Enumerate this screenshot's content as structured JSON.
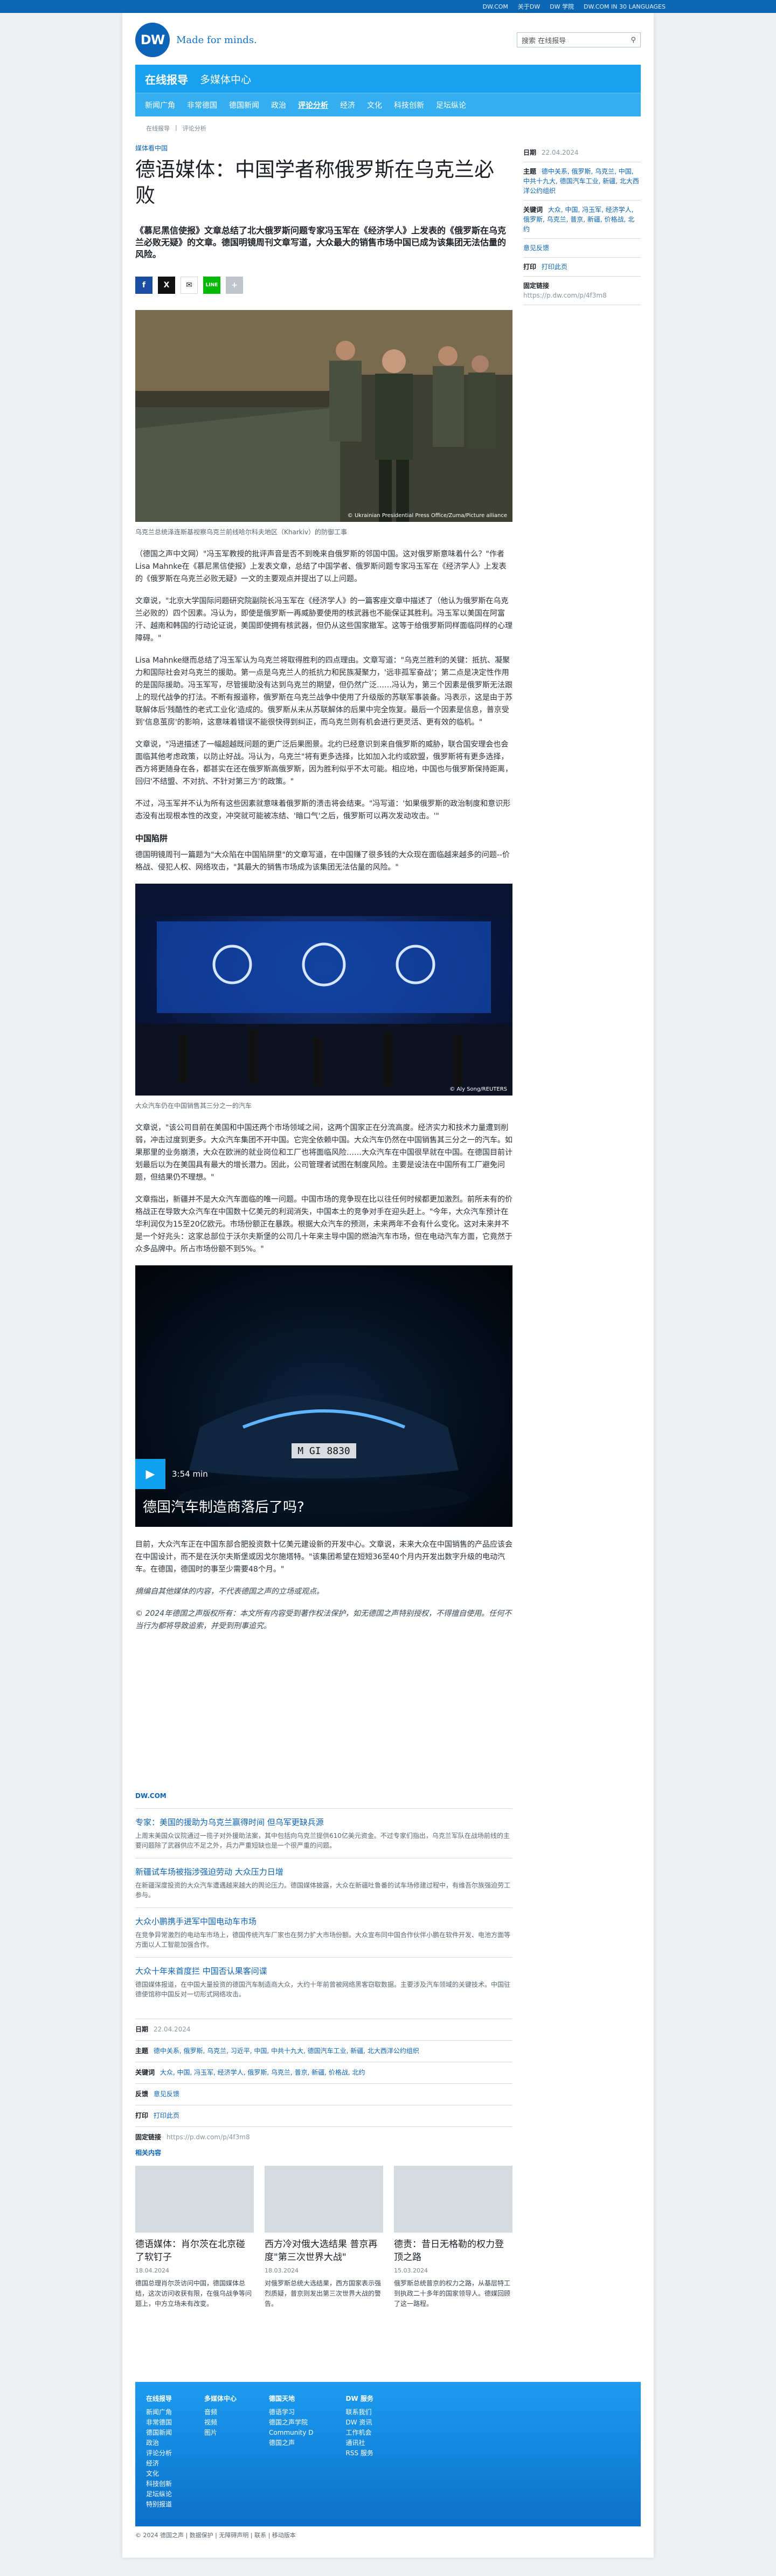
{
  "topbar": {
    "links": [
      "DW.COM",
      "关于DW",
      "DW 学院",
      "DW.COM IN 30 LANGUAGES"
    ]
  },
  "header": {
    "logo": "DW",
    "tagline": "Made for minds.",
    "search_placeholder": "搜索 在线报导"
  },
  "nav": {
    "title": "在线报导",
    "subtitle": "多媒体中心",
    "items": [
      "新闻广角",
      "非常德国",
      "德国新闻",
      "政治",
      "评论分析",
      "经济",
      "文化",
      "科技创新",
      "足坛纵论"
    ]
  },
  "breadcrumb": [
    "在线报导",
    "评论分析"
  ],
  "article": {
    "kicker": "媒体看中国",
    "title": "德语媒体：中国学者称俄罗斯在乌克兰必败",
    "lead": "《慕尼黑信使报》文章总结了北大俄罗斯问题专家冯玉军在《经济学人》上发表的《俄罗斯在乌克兰必败无疑》的文章。德国明镜周刊文章写道，大众最大的销售市场中国已成为该集团无法估量的风险。",
    "share": [
      "f",
      "X",
      "✉",
      "LINE",
      "+"
    ],
    "img1_credit": "© Ukrainian Presidential Press Office/Zuma/Picture alliance",
    "img1_caption": "乌克兰总统泽连斯基视察乌克兰前线哈尔科夫地区（Kharkiv）的防御工事",
    "p1": "（德国之声中文网）\"冯玉军教授的批评声音是否不到晚来自俄罗斯的邻国中国。这对俄罗斯意味着什么？\"作者Lisa Mahnke在《慕尼黑信使报》上发表文章，总结了中国学者、俄罗斯问题专家冯玉军在《经济学人》上发表的《俄罗斯在乌克兰必败无疑》一文的主要观点并提出了以上问题。",
    "p2": "文章说，\"北京大学国际问题研究院副院长冯玉军在《经济学人》的一篇客座文章中描述了（他认为俄罗斯在乌克兰必败的）四个因素。冯认为，即使是俄罗斯一再威胁要使用的核武器也不能保证其胜利。冯玉军以美国在阿富汗、越南和韩国的行动论证说，美国即使拥有核武器，但仍从这些国家撤军。这等于给俄罗斯同样面临同样的心理障碍。\"",
    "p3": "Lisa Mahnke继而总结了冯玉军认为乌克兰将取得胜利的四点理由。文章写道：\"乌克兰胜利的关键：抵抗、凝聚力和国际社会对乌克兰的援助。第一点是乌克兰人的抵抗力和民族凝聚力，'远非孤军奋战'；第二点是决定性作用的是国际援助。冯玉军写，尽管援助没有达到乌克兰的期望，但仍然广泛……冯认为，第三个因素是俄罗斯无法跟上的现代战争的打法。不断有报道称，俄罗斯在乌克兰战争中使用了升级版的苏联军事装备。冯表示，这是由于苏联解体后'残酷性的老式工业化'造成的。俄罗斯从未从苏联解体的后果中完全恢复。最后一个因素是信息，普京受到'信息茧房'的影响，这意味着错误不能很快得到纠正，而乌克兰则有机会进行更灵活、更有效的临机。\"",
    "p4": "文章说，\"冯进描述了一幅超越既问题的更广泛后果图景。北约已经意识到来自俄罗斯的威胁，联合国安理会也会面临其他考虑政策，以防止好战。冯认为，乌克兰\"将有更多选择，比如加入北约或欧盟，俄罗斯将有更多选择，西方将更随身在各，都甚实在还在俄罗斯高俄罗斯，因为胜利似乎不太可能。相应地，中国也与俄罗斯保持距离，回归'不结盟、不对抗、不针对第三方'的政策。\"",
    "p5": "不过，冯玉军并不认为所有这些因素就意味着俄罗斯的溃击将会结束。\"冯写道：'如果俄罗斯的政治制度和意识形态没有出现根本性的改变，冲突就可能被冻结、'暗口气'之后，俄罗斯可以再次发动攻击。'\"",
    "h2": "中国陷阱",
    "p6": "德国明镜周刊一篇题为\"大众陷在中国陷阱里\"的文章写道，在中国赚了很多钱的大众现在面临越来越多的问题--价格战、侵犯人权、网络攻击，\"其最大的销售市场成为该集团无法估量的风险。\"",
    "img2_credit": "© Aly Song/REUTERS",
    "img2_caption": "大众汽车仍在中国销售其三分之一的汽车",
    "p7": "文章说，\"该公司目前在美国和中国还两个市场领域之间，这两个国家正在分流高度。经济实力和技术力量遭到削弱，冲击过度到更多。大众汽车集团不开中国。它完全依赖中国。大众汽车仍然在中国销售其三分之一的汽车。如果那里的业务崩溃，大众在欧洲的就业岗位和工厂也将面临风险……大众汽车在中国很早就在中国。在德国目前计划最后以为在美国具有最大的增长潜力。因此，公司管理者试图在制度风险。主要是设法在中国所有工厂避免问题，但结果仍不理想。\"",
    "p8": "文章指出，新疆并不是大众汽车面临的唯一问题。中国市场的竞争现在比以往任何时候都更加激烈。前所未有的价格战正在导致大众汽车在中国数十亿美元的利润消失，中国本土的竞争对手在迎头赶上。\"今年，大众汽车预计在华利润仅为15至20亿欧元。市场份额正在暴跌。根据大众汽车的预测，未来两年不会有什么变化。这对未来并不是一个好兆头：这家总部位于沃尔夫斯堡的公司几十年来主导中国的燃油汽车市场，但在电动汽车方面，它竟然于众多品牌中。所占市场份额不到5%。\"",
    "video_duration": "3:54 min",
    "video_title": "德国汽车制造商落后了吗?",
    "p9": "目前，大众汽车正在中国东部合肥投资数十亿美元建设新的开发中心。文章说，未来大众在中国销售的产品应该会在中国设计，而不是在沃尔夫斯堡或因戈尔施塔特。\"该集团希望在短短36至40个月内开发出数字升级的电动汽车。在德国，德国时的事至少需要48个月。\"",
    "note": "摘编自其他媒体的内容，不代表德国之声的立场或观点。",
    "copyright": "© 2024年德国之声版权所有：本文所有内容受到著作权法保护，如无德国之声特别授权，不得擅自使用。任何不当行为都将导致追索，并受到刑事追究。"
  },
  "sidebar": {
    "date_label": "日期",
    "date": "22.04.2024",
    "topics_label": "主题",
    "topics": "德中关系, 俄罗斯, 乌克兰, 中国, 中共十九大, 德国汽车工业, 新疆, 北大西洋公约组织",
    "keywords_label": "关键词",
    "keywords": "大众, 中国, 冯玉军, 经济学人, 俄罗斯, 乌克兰, 普京, 新疆, 价格战, 北约",
    "feedback": "意见反馈",
    "print_label": "打印",
    "print": "打印此页",
    "permalink_label": "固定链接",
    "permalink": "https://p.dw.com/p/4f3m8"
  },
  "related": {
    "head": "DW.COM",
    "items": [
      {
        "title": "专家：美国的援助为乌克兰赢得时间 但乌军更缺兵源",
        "desc": "上周末美国众议院通过一揽子对外援助法案，其中包括向乌克兰提供610亿美元资金。不过专家们指出，乌克兰军队在战场前线的主要问题除了武器供应不足之外，兵力严重短缺也是一个很严重的问题。"
      },
      {
        "title": "新疆试车场被指涉强迫劳动 大众压力日增",
        "desc": "在新疆深度投资的大众汽车遭遇越来越大的舆论压力。德国媒体披露，大众在新疆吐鲁番的试车场修建过程中，有维吾尔族强迫劳工参与。"
      },
      {
        "title": "大众小鹏携手进军中国电动车市场",
        "desc": "在竞争异常激烈的电动车市场上，德国传统汽车厂家也在努力扩大市场份额。大众宣布同中国合作伙伴小鹏在软件开发、电池方面等方面以人工智能加强合作。"
      },
      {
        "title": "大众十年来首度拦 中国否认果客问谍",
        "desc": "德国媒体报道，在中国大量投资的德国汽车制造商大众，大约十年前曾被网络黑客窃取数据。主要涉及汽车领域的关键技术。中国驻德使馆称中国反对一切形式网络攻击。"
      }
    ]
  },
  "meta": {
    "date_label": "日期",
    "date": "22.04.2024",
    "topics_label": "主题",
    "topics": "德中关系, 俄罗斯, 乌克兰, 习近平, 中国, 中共十九大, 德国汽车工业, 新疆, 北大西洋公约组织",
    "keywords_label": "关键词",
    "keywords": "大众, 中国, 冯玉军, 经济学人, 俄罗斯, 乌克兰, 普京, 新疆, 价格战, 北约",
    "feedback_label": "反馈",
    "feedback": "意见反馈",
    "print_label": "打印",
    "print": "打印此页",
    "permalink_label": "固定链接",
    "permalink": "https://p.dw.com/p/4f3m8"
  },
  "more": {
    "head": "相关内容",
    "cards": [
      {
        "title": "德语媒体：肖尔茨在北京碰了软钉子",
        "date": "18.04.2024",
        "desc": "德国总理肖尔茨访问中国，德国媒体总结，这次访问收获有限，在俄乌战争等问题上，中方立场未有改变。"
      },
      {
        "title": "西方冷对俄大选结果 普京再度\"第三次世界大战\"",
        "date": "18.03.2024",
        "desc": "对俄罗斯总统大选结果，西方国家表示强烈质疑，普京则发出第三次世界大战的警告。"
      },
      {
        "title": "德责：昔日无格勒的权力登顶之路",
        "date": "15.03.2024",
        "desc": "俄罗斯总统普京的权力之路，从基层特工到执政二十多年的国家领导人。德媒回顾了这一路程。"
      },
      {
        "title": "",
        "date": "",
        "desc": ""
      }
    ]
  },
  "footer": {
    "cols": [
      {
        "head": "在线报导",
        "items": [
          "新闻广角",
          "非常德国",
          "德国新闻",
          "政治",
          "评论分析",
          "经济",
          "文化",
          "科技创新",
          "足坛纵论",
          "特别报道"
        ]
      },
      {
        "head": "多媒体中心",
        "items": [
          "音频",
          "视频",
          "图片"
        ]
      },
      {
        "head": "德国天地",
        "items": [
          "德语学习",
          "德国之声学院",
          "Community D",
          "德国之声"
        ]
      },
      {
        "head": "DW 服务",
        "items": [
          "联系我们",
          "DW 资讯",
          "工作机会",
          "通讯社",
          "RSS 服务"
        ]
      }
    ],
    "bottom": "© 2024 德国之声 | 数据保护 | 无障碍声明 | 联系 | 移动版本"
  }
}
